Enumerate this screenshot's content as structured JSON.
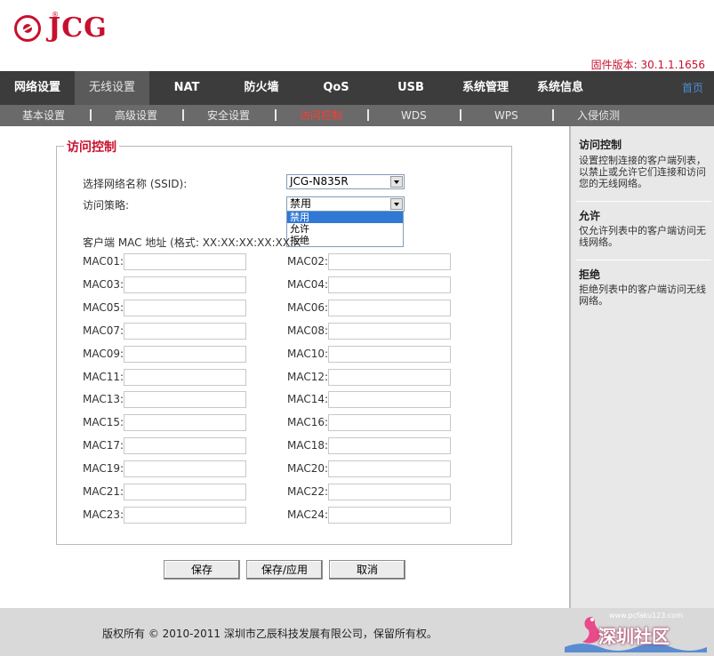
{
  "header": {
    "logo_text": "JCG",
    "firmware_label": "固件版本:",
    "firmware_version": "30.1.1.1656"
  },
  "nav": {
    "items": [
      "网络设置",
      "无线设置",
      "NAT",
      "防火墙",
      "QoS",
      "USB",
      "系统管理",
      "系统信息"
    ],
    "active_index": 1,
    "home_link": "首页"
  },
  "subnav": {
    "items": [
      "基本设置",
      "高级设置",
      "安全设置",
      "访问控制",
      "WDS",
      "WPS",
      "入侵侦测"
    ],
    "active_index": 3
  },
  "form": {
    "legend": "访问控制",
    "ssid_label": "选择网络名称 (SSID):",
    "ssid_value": "JCG-N835R",
    "policy_label": "访问策略:",
    "policy_value": "禁用",
    "policy_options": [
      "禁用",
      "允许",
      "拒绝"
    ],
    "policy_highlighted_index": 0,
    "mac_header": "客户端 MAC 地址 (格式: XX:XX:XX:XX:XX:X",
    "mac_labels": [
      "MAC01:",
      "MAC02:",
      "MAC03:",
      "MAC04:",
      "MAC05:",
      "MAC06:",
      "MAC07:",
      "MAC08:",
      "MAC09:",
      "MAC10:",
      "MAC11:",
      "MAC12:",
      "MAC13:",
      "MAC14:",
      "MAC15:",
      "MAC16:",
      "MAC17:",
      "MAC18:",
      "MAC19:",
      "MAC20:",
      "MAC21:",
      "MAC22:",
      "MAC23:",
      "MAC24:"
    ],
    "mac_values": [
      "",
      "",
      "",
      "",
      "",
      "",
      "",
      "",
      "",
      "",
      "",
      "",
      "",
      "",
      "",
      "",
      "",
      "",
      "",
      "",
      "",
      "",
      "",
      ""
    ]
  },
  "buttons": {
    "save": "保存",
    "save_apply": "保存/应用",
    "cancel": "取消"
  },
  "help": {
    "sections": [
      {
        "title": "访问控制",
        "text": "设置控制连接的客户端列表，以禁止或允许它们连接和访问您的无线网络。"
      },
      {
        "title": "允许",
        "text": "仅允许列表中的客户端访问无线网络。"
      },
      {
        "title": "拒绝",
        "text": "拒绝列表中的客户端访问无线网络。"
      }
    ]
  },
  "footer": {
    "copyright": "版权所有 © 2010-2011 深圳市乙辰科技发展有限公司，保留所有权。"
  },
  "watermark": {
    "url": "www.pcfaku123.com",
    "text": "深圳社区"
  },
  "colors": {
    "brand_red": "#c8102e",
    "nav_bg": "#3c3c3c",
    "subnav_bg": "#6a6a6a",
    "active_sub": "#ff3b30",
    "home_link": "#4a8fd6"
  }
}
